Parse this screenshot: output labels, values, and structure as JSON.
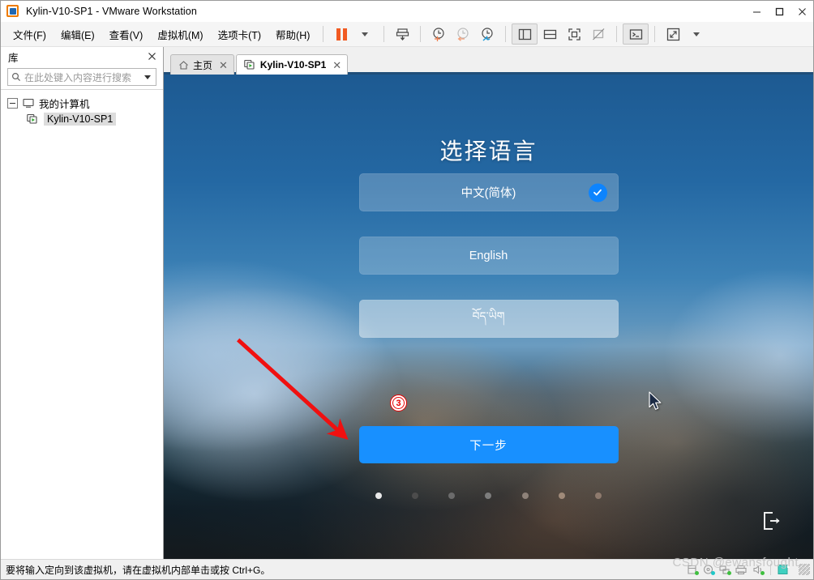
{
  "window": {
    "title": "Kylin-V10-SP1 - VMware Workstation",
    "minimize_label": "Minimize",
    "maximize_label": "Maximize",
    "close_label": "Close"
  },
  "menubar": {
    "items": [
      {
        "label": "文件(F)",
        "name": "menu-file"
      },
      {
        "label": "编辑(E)",
        "name": "menu-edit"
      },
      {
        "label": "查看(V)",
        "name": "menu-view"
      },
      {
        "label": "虚拟机(M)",
        "name": "menu-vm"
      },
      {
        "label": "选项卡(T)",
        "name": "menu-tabs"
      },
      {
        "label": "帮助(H)",
        "name": "menu-help"
      }
    ]
  },
  "toolbar": {
    "pause_label": "暂停",
    "dropdown_label": "电源选项",
    "snapshot_label": "快照",
    "revert_label": "恢复快照",
    "snapshot_mgr_label": "快照管理器",
    "sidebar_label": "显示或隐藏库",
    "console_label": "控制台视图",
    "fullscreen_label": "全屏",
    "unity_label": "Unity 模式",
    "terminal_label": "发送 Ctrl+Alt+Del",
    "stretch_label": "自由拉伸"
  },
  "library": {
    "title": "库",
    "close_label": "关闭库",
    "search_placeholder": "在此处键入内容进行搜索",
    "tree": [
      {
        "label": "我的计算机",
        "level": 0,
        "selected": false
      },
      {
        "label": "Kylin-V10-SP1",
        "level": 1,
        "selected": true
      }
    ]
  },
  "tabs": [
    {
      "label": "主页",
      "icon": "home-icon",
      "active": false,
      "close_glyph": "✕"
    },
    {
      "label": "Kylin-V10-SP1",
      "icon": "vm-icon",
      "active": true,
      "close_glyph": "✕"
    }
  ],
  "guest": {
    "title": "选择语言",
    "languages": [
      {
        "label": "中文(简体)",
        "selected": true,
        "hovered": false,
        "script": "han"
      },
      {
        "label": "English",
        "selected": false,
        "hovered": false,
        "script": "latin"
      },
      {
        "label": "བོད་ཡིག",
        "selected": false,
        "hovered": true,
        "script": "tibetan"
      }
    ],
    "next_button": "下一步",
    "exit_label": "退出",
    "step_dots": [
      {
        "active": true,
        "color": "#e9e9e9"
      },
      {
        "active": false,
        "color": "#4c4c4c"
      },
      {
        "active": false,
        "color": "#6b6b6b"
      },
      {
        "active": false,
        "color": "#7d7d7d"
      },
      {
        "active": false,
        "color": "#8e8279"
      },
      {
        "active": false,
        "color": "#a08a79"
      },
      {
        "active": false,
        "color": "#8e7a6d"
      }
    ],
    "accent_color": "#1890ff",
    "check_color": "#0d84fe"
  },
  "annotation": {
    "badge": "3",
    "color": "#e60000"
  },
  "statusbar": {
    "message": "要将输入定向到该虚拟机，请在虚拟机内部单击或按 Ctrl+G。",
    "devices": [
      {
        "name": "hard-disk-device-icon",
        "dot": "#3fbf3f"
      },
      {
        "name": "cd-dvd-device-icon",
        "dot": "#1fc8c8"
      },
      {
        "name": "network-device-icon",
        "dot": "#3fbf3f"
      },
      {
        "name": "printer-device-icon",
        "dot": ""
      },
      {
        "name": "sound-device-icon",
        "dot": "#3fbf3f"
      },
      {
        "name": "usb-device-icon",
        "dot": ""
      }
    ]
  },
  "watermark": "CSDN @ewansfought"
}
